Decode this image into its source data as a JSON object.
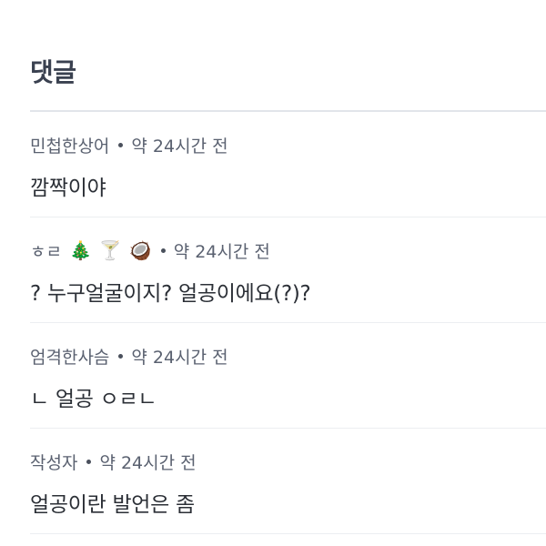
{
  "section": {
    "title": "댓글"
  },
  "comments": [
    {
      "author": "민첩한상어",
      "emojis": [],
      "time": "약 24시간 전",
      "body": "깜짝이야"
    },
    {
      "author": "ㅎㄹ",
      "emojis": [
        "🎄",
        "🍸",
        "🥥"
      ],
      "time": "약 24시간 전",
      "body": "? 누구얼굴이지? 얼공이에요(?)?"
    },
    {
      "author": "엄격한사슴",
      "emojis": [],
      "time": "약 24시간 전",
      "body": "ㄴ 얼공 ㅇㄹㄴ"
    },
    {
      "author": "작성자",
      "emojis": [],
      "time": "약 24시간 전",
      "body": "얼공이란 발언은 좀"
    }
  ],
  "colors": {
    "title": "#3a4150",
    "meta": "#5a6170",
    "body": "#2b2f36",
    "divider": "#e2e5ea"
  }
}
